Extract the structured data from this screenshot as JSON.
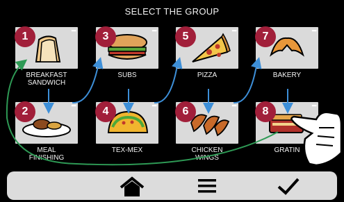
{
  "screen": {
    "title": "SELECT THE GROUP"
  },
  "groups": [
    {
      "number": "1",
      "label_line1": "BREAKFAST",
      "label_line2": "SANDWICH",
      "icon": "sandwich-icon"
    },
    {
      "number": "2",
      "label_line1": "MEAL",
      "label_line2": "FINISHING",
      "icon": "meal-plate-icon"
    },
    {
      "number": "3",
      "label_line1": "SUBS",
      "label_line2": "",
      "icon": "sub-sandwich-icon"
    },
    {
      "number": "4",
      "label_line1": "TEX-MEX",
      "label_line2": "",
      "icon": "taco-icon"
    },
    {
      "number": "5",
      "label_line1": "PIZZA",
      "label_line2": "",
      "icon": "pizza-slice-icon"
    },
    {
      "number": "6",
      "label_line1": "CHICKEN",
      "label_line2": "WINGS",
      "icon": "chicken-wings-icon"
    },
    {
      "number": "7",
      "label_line1": "BAKERY",
      "label_line2": "",
      "icon": "croissant-icon"
    },
    {
      "number": "8",
      "label_line1": "GRATIN",
      "label_line2": "",
      "icon": "gratin-dish-icon"
    }
  ],
  "toolbar": {
    "home": "home-icon",
    "menu": "hamburger-menu-icon",
    "confirm": "checkmark-icon"
  },
  "colors": {
    "background": "#000000",
    "tile": "#dadada",
    "badge": "#a11f3a",
    "arrow": "#3d8fd8",
    "return_arrow": "#2e9a55",
    "toolbar": "#dcdcdc"
  }
}
